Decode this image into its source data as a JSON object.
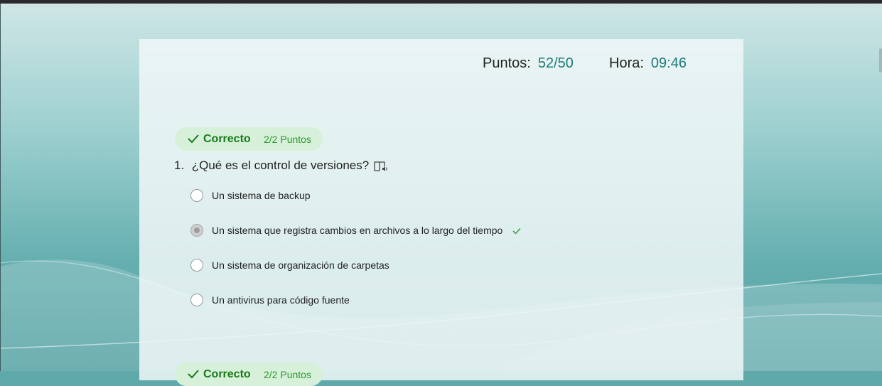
{
  "score": {
    "label": "Puntos:",
    "value": "52/50"
  },
  "time": {
    "label": "Hora:",
    "value": "09:46"
  },
  "questions": [
    {
      "status": "Correcto",
      "points": "2/2 Puntos",
      "number": "1.",
      "text": "¿Qué es el control de versiones?",
      "options": [
        {
          "label": "Un sistema de backup",
          "selected": false,
          "correct": false
        },
        {
          "label": "Un sistema que registra cambios en archivos a lo largo del tiempo",
          "selected": true,
          "correct": true
        },
        {
          "label": "Un sistema de organización de carpetas",
          "selected": false,
          "correct": false
        },
        {
          "label": "Un antivirus para código fuente",
          "selected": false,
          "correct": false
        }
      ]
    },
    {
      "status": "Correcto",
      "points": "2/2 Puntos"
    }
  ],
  "colors": {
    "accent": "#1d7a7b",
    "correct": "#1a7a1a",
    "correct_bg": "#d6f0d9"
  }
}
